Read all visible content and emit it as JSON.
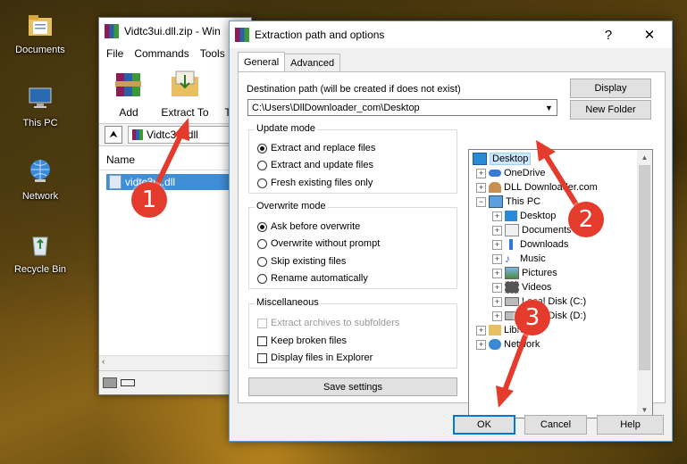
{
  "desktop": {
    "icons": [
      {
        "label": "Documents",
        "icon": "folder-icon"
      },
      {
        "label": "This PC",
        "icon": "computer-icon"
      },
      {
        "label": "Network",
        "icon": "network-globe-icon"
      },
      {
        "label": "Recycle Bin",
        "icon": "recycle-bin-icon"
      }
    ]
  },
  "winrar": {
    "title": "Vidtc3ui.dll.zip - Win",
    "menu": [
      "File",
      "Commands",
      "Tools"
    ],
    "toolbar": {
      "add": "Add",
      "extract_to": "Extract To",
      "more": "T"
    },
    "path": "Vidtc3ui.dll",
    "column_name": "Name",
    "file": "vidtc3ui.dll"
  },
  "dialog": {
    "title": "Extraction path and options",
    "help_glyph": "?",
    "close_glyph": "✕",
    "tabs": [
      "General",
      "Advanced"
    ],
    "destination_label": "Destination path (will be created if does not exist)",
    "destination_value": "C:\\Users\\DllDownloader_com\\Desktop",
    "display_button": "Display",
    "new_folder_button": "New Folder",
    "update_mode": {
      "title": "Update mode",
      "options": [
        "Extract and replace files",
        "Extract and update files",
        "Fresh existing files only"
      ],
      "selected": 0
    },
    "overwrite_mode": {
      "title": "Overwrite mode",
      "options": [
        "Ask before overwrite",
        "Overwrite without prompt",
        "Skip existing files",
        "Rename automatically"
      ],
      "selected": 0
    },
    "misc": {
      "title": "Miscellaneous",
      "options": [
        "Extract archives to subfolders",
        "Keep broken files",
        "Display files in Explorer"
      ]
    },
    "save_settings": "Save settings",
    "tree": [
      {
        "label": "Desktop",
        "selected": true
      },
      {
        "label": "OneDrive"
      },
      {
        "label": "DLL Downloader.com"
      },
      {
        "label": "This PC"
      },
      {
        "label": "Desktop"
      },
      {
        "label": "Documents"
      },
      {
        "label": "Downloads"
      },
      {
        "label": "Music"
      },
      {
        "label": "Pictures"
      },
      {
        "label": "Videos"
      },
      {
        "label": "Local Disk (C:)"
      },
      {
        "label": "Local Disk (D:)"
      },
      {
        "label": "Libraries"
      },
      {
        "label": "Network"
      }
    ],
    "ok_button": "OK",
    "cancel_button": "Cancel",
    "help_button": "Help"
  },
  "markers": [
    "1",
    "2",
    "3"
  ],
  "colors": {
    "marker_red": "#e53b2c",
    "selection_blue": "#3f8fd8",
    "tree_select": "#cce8ff"
  }
}
